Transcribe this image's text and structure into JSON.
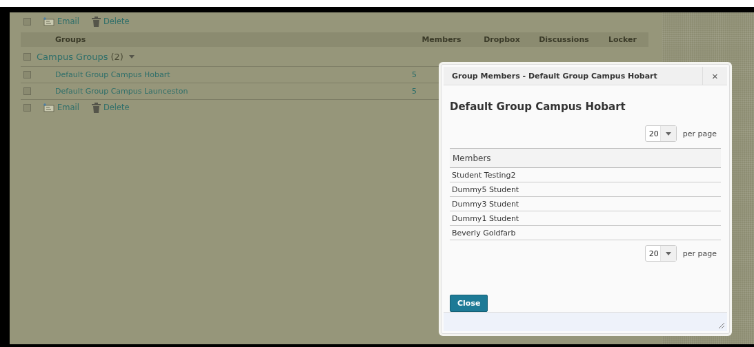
{
  "top_toolbar": {
    "checked": false,
    "actions": [
      {
        "kind": "email",
        "label": "Email"
      },
      {
        "kind": "delete",
        "label": "Delete"
      }
    ]
  },
  "table": {
    "columns": [
      "Groups",
      "Members",
      "Dropbox",
      "Discussions",
      "Locker"
    ],
    "category": {
      "checked": false,
      "name": "Campus Groups",
      "count": "(2)",
      "expanded": true,
      "children": [
        {
          "checked": false,
          "name": "Default Group Campus Hobart",
          "members": "5"
        },
        {
          "checked": false,
          "name": "Default Group Campus Launceston",
          "members": "5"
        }
      ]
    }
  },
  "bottom_toolbar": {
    "checked": false,
    "actions": [
      {
        "kind": "email",
        "label": "Email"
      },
      {
        "kind": "delete",
        "label": "Delete"
      }
    ]
  },
  "dialog": {
    "title": "Group Members - Default Group Campus Hobart",
    "close_icon": "×",
    "heading": "Default Group Campus Hobart",
    "top_pager": {
      "value": "20",
      "label": "per page"
    },
    "members_header": "Members",
    "members": [
      "Student Testing2",
      "Dummy5 Student",
      "Dummy3 Student",
      "Dummy1 Student",
      "Beverly Goldfarb"
    ],
    "bottom_pager": {
      "value": "20",
      "label": "per page"
    },
    "close_button": "Close"
  }
}
